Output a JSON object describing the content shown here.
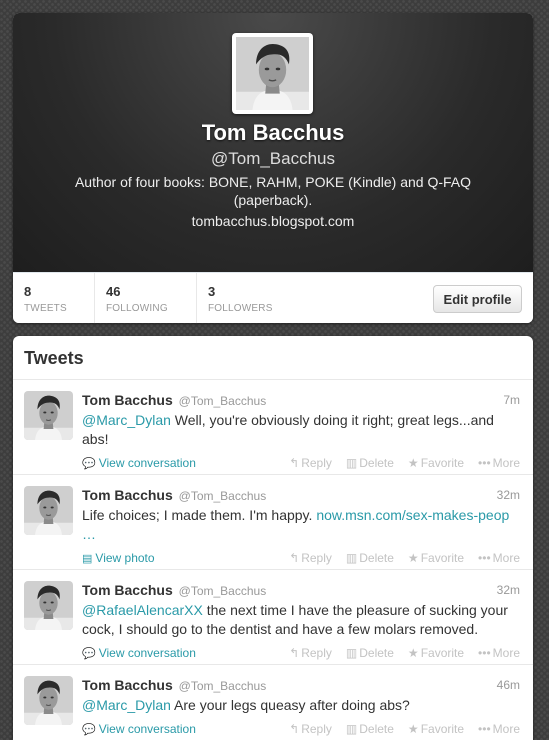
{
  "profile": {
    "name": "Tom Bacchus",
    "handle": "@Tom_Bacchus",
    "bio": "Author of four books: BONE, RAHM, POKE (Kindle) and Q-FAQ (paperback).",
    "url": "tombacchus.blogspot.com",
    "avatar_icon": "profile-photo"
  },
  "stats": {
    "tweets_count": "8",
    "tweets_label": "TWEETS",
    "following_count": "46",
    "following_label": "FOLLOWING",
    "followers_count": "3",
    "followers_label": "FOLLOWERS"
  },
  "edit_profile_label": "Edit profile",
  "tweets_heading": "Tweets",
  "actions": {
    "reply": "Reply",
    "delete": "Delete",
    "favorite": "Favorite",
    "more": "More"
  },
  "tweets": [
    {
      "name": "Tom Bacchus",
      "handle": "@Tom_Bacchus",
      "time": "7m",
      "mention": "@Marc_Dylan",
      "text": " Well, you're obviously doing it right; great legs...and abs!",
      "expand": "View conversation"
    },
    {
      "name": "Tom Bacchus",
      "handle": "@Tom_Bacchus",
      "time": "32m",
      "text": "Life choices; I made them. I'm happy. ",
      "link": "now.msn.com/sex-makes-peop …",
      "expand": "View photo"
    },
    {
      "name": "Tom Bacchus",
      "handle": "@Tom_Bacchus",
      "time": "32m",
      "mention": "@RafaelAlencarXX",
      "text": " the next time I have the pleasure of sucking your cock, I should go to the dentist and have a few molars removed.",
      "expand": "View conversation"
    },
    {
      "name": "Tom Bacchus",
      "handle": "@Tom_Bacchus",
      "time": "46m",
      "mention": "@Marc_Dylan",
      "text": " Are your legs queasy after doing abs?",
      "expand": "View conversation"
    }
  ],
  "colors": {
    "accent": "#2a9aa8",
    "muted": "#999999",
    "action": "#c3c3c3"
  }
}
